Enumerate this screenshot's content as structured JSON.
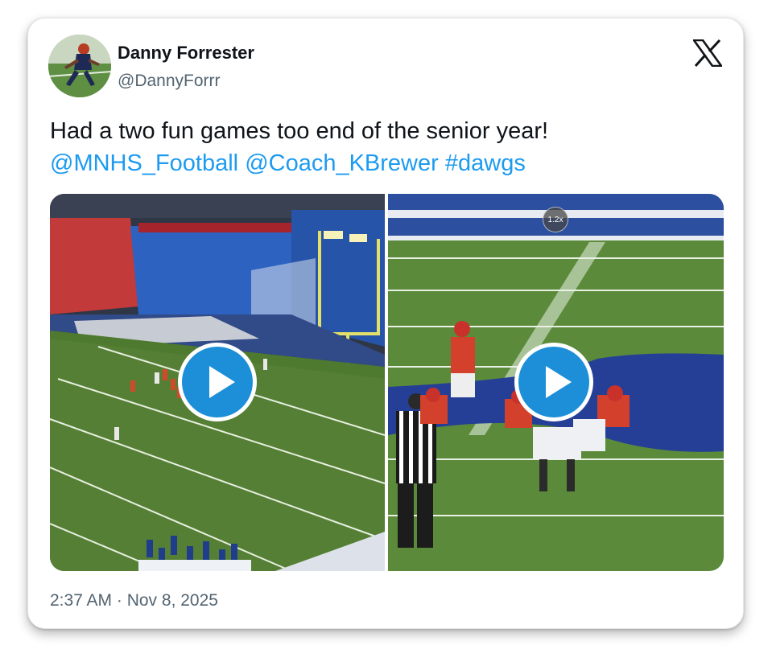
{
  "tweet": {
    "author_name": "Danny Forrester",
    "author_handle": "@DannyForrr",
    "text_plain": "Had a two fun games too end of the senior year!",
    "mention_1": "@MNHS_Football",
    "mention_2": "@Coach_KBrewer",
    "hashtag": "#dawgs",
    "timestamp": "2:37 AM · Nov 8, 2025"
  },
  "media": {
    "videos": [
      {
        "label": "video-1"
      },
      {
        "label": "video-2",
        "speed_badge": "1.2x"
      }
    ]
  },
  "icons": {
    "brand": "x-logo-icon",
    "play": "play-icon"
  },
  "colors": {
    "link": "#1d9bf0",
    "play_button": "#1d8fd8",
    "text": "#0f1419",
    "secondary_text": "#536471"
  }
}
